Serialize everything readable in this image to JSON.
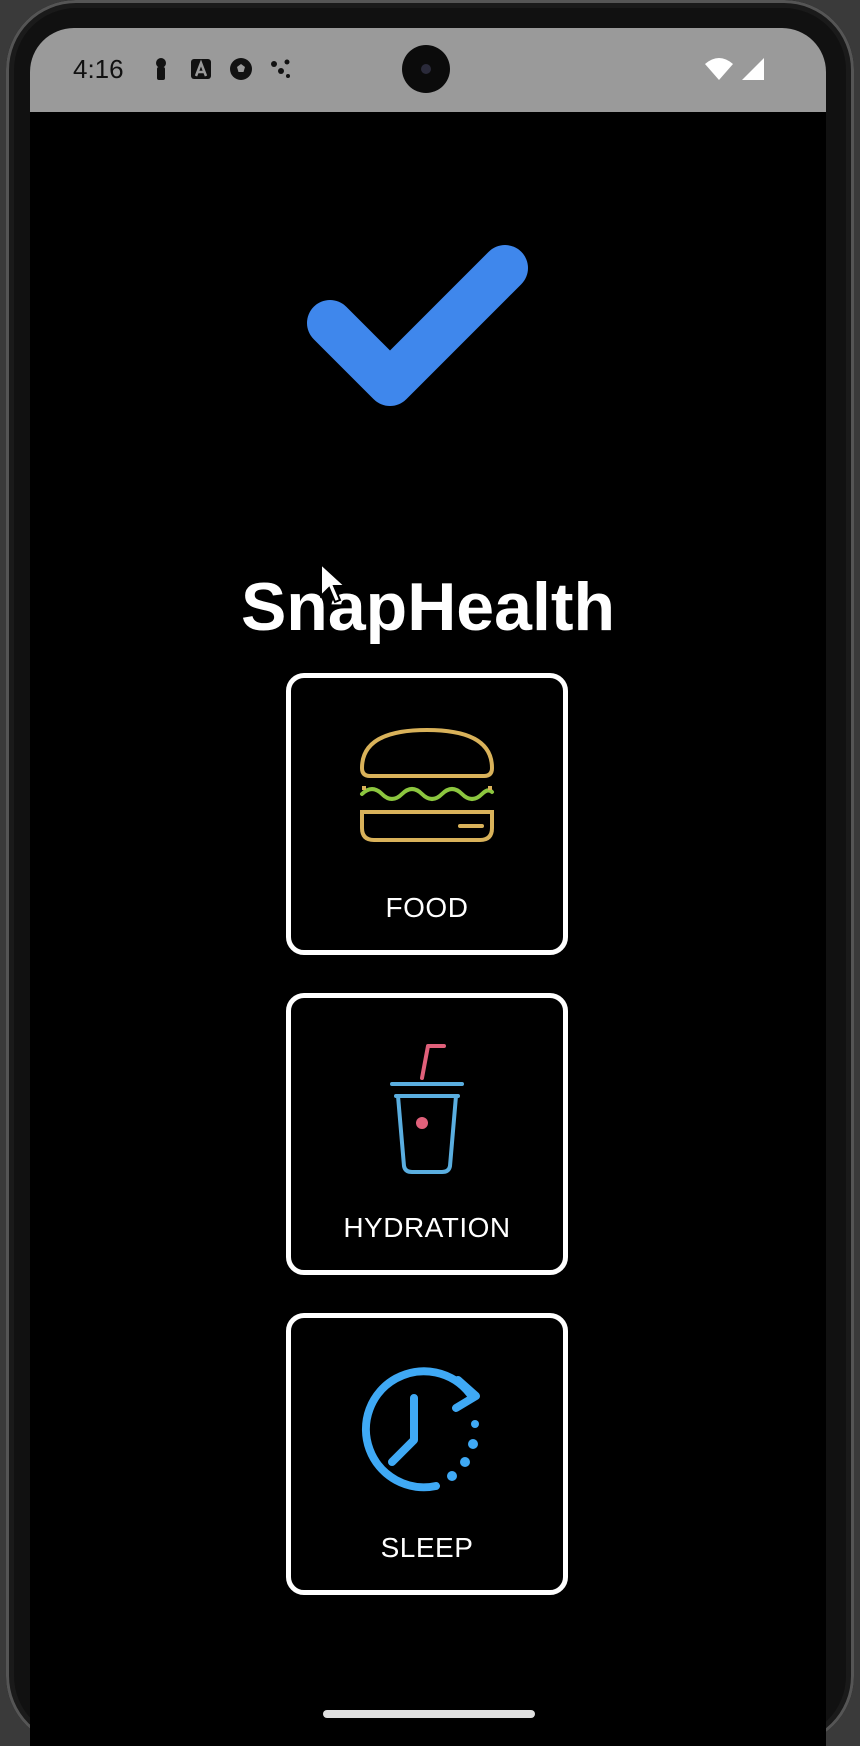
{
  "status_bar": {
    "time": "4:16",
    "left_icons": [
      "person-key-icon",
      "a-box-icon",
      "soccer-ball-icon",
      "dots-icon"
    ],
    "right_icons": [
      "wifi-icon",
      "signal-icon"
    ]
  },
  "app": {
    "title": "SnapHealth",
    "logo_icon": "checkmark-icon",
    "logo_color": "#3f87ec"
  },
  "categories": [
    {
      "label": "FOOD",
      "icon": "burger-icon",
      "icon_color": "#d9b25a",
      "accent_color": "#8cc63f"
    },
    {
      "label": "HYDRATION",
      "icon": "drink-cup-icon",
      "icon_color": "#5aaee0",
      "accent_color": "#e0607a"
    },
    {
      "label": "SLEEP",
      "icon": "clock-redo-icon",
      "icon_color": "#3fa9f5"
    }
  ]
}
